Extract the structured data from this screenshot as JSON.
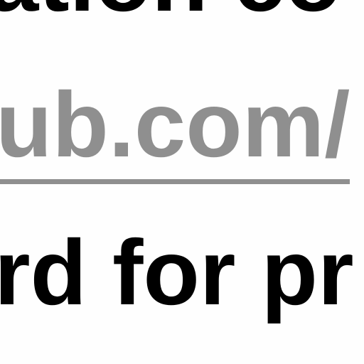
{
  "document": {
    "line_top": "ation co",
    "link_text": "ub.com/",
    "line_bottom": "rd for pr"
  },
  "colors": {
    "text": "#000000",
    "link": "#8f8f8f",
    "background": "#fefefe"
  }
}
